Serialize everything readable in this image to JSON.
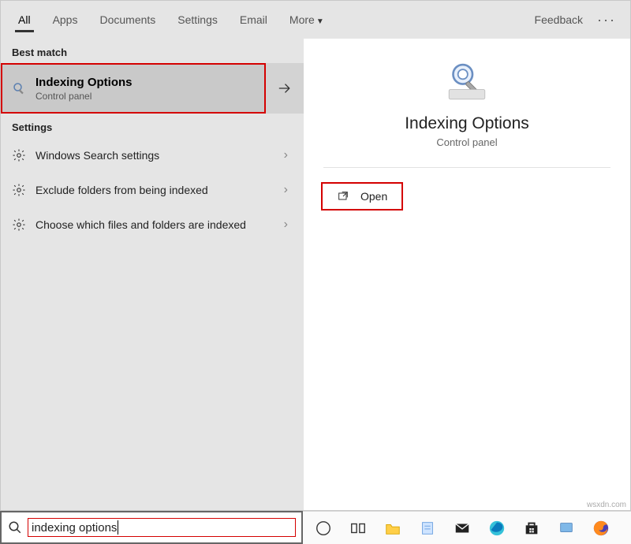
{
  "tabs": {
    "items": [
      "All",
      "Apps",
      "Documents",
      "Settings",
      "Email"
    ],
    "more": "More",
    "feedback": "Feedback"
  },
  "left": {
    "best_match_label": "Best match",
    "best": {
      "title": "Indexing Options",
      "subtitle": "Control panel"
    },
    "settings_label": "Settings",
    "rows": [
      {
        "label": "Windows Search settings"
      },
      {
        "label": "Exclude folders from being indexed"
      },
      {
        "label": "Choose which files and folders are indexed"
      }
    ]
  },
  "detail": {
    "title": "Indexing Options",
    "subtitle": "Control panel",
    "open_label": "Open"
  },
  "search": {
    "query": "indexing options"
  },
  "watermark": "wsxdn.com"
}
